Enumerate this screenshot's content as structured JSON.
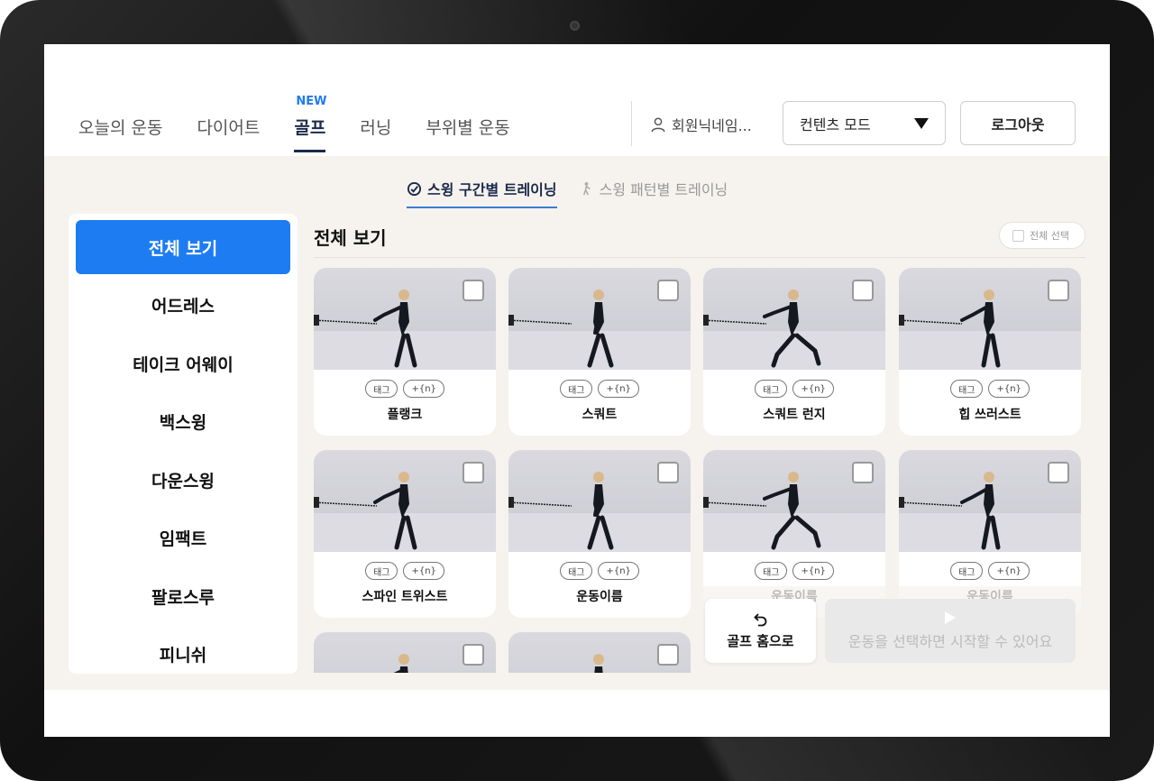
{
  "nav": {
    "items": [
      {
        "label": "오늘의 운동",
        "active": false
      },
      {
        "label": "다이어트",
        "active": false
      },
      {
        "label": "골프",
        "active": true,
        "badge": "NEW"
      },
      {
        "label": "러닝",
        "active": false
      },
      {
        "label": "부위별 운동",
        "active": false
      }
    ]
  },
  "header": {
    "user_name": "회원닉네임...",
    "mode_label": "컨텐츠 모드",
    "logout_label": "로그아웃"
  },
  "subtabs": [
    {
      "label": "스윙 구간별 트레이닝",
      "active": true,
      "icon": "swing-section-icon"
    },
    {
      "label": "스윙 패턴별 트레이닝",
      "active": false,
      "icon": "golfer-icon"
    }
  ],
  "sidebar": {
    "items": [
      {
        "label": "전체 보기",
        "active": true
      },
      {
        "label": "어드레스",
        "active": false
      },
      {
        "label": "테이크 어웨이",
        "active": false
      },
      {
        "label": "백스윙",
        "active": false
      },
      {
        "label": "다운스윙",
        "active": false
      },
      {
        "label": "임팩트",
        "active": false
      },
      {
        "label": "팔로스루",
        "active": false
      },
      {
        "label": "피니쉬",
        "active": false
      }
    ]
  },
  "main": {
    "title": "전체 보기",
    "select_all_label": "전체 선택",
    "cards": [
      {
        "name": "플랭크",
        "tag": "태그",
        "more": "+{n}"
      },
      {
        "name": "스쿼트",
        "tag": "태그",
        "more": "+{n}"
      },
      {
        "name": "스쿼트 런지",
        "tag": "태그",
        "more": "+{n}"
      },
      {
        "name": "힙 쓰러스트",
        "tag": "태그",
        "more": "+{n}"
      },
      {
        "name": "스파인 트위스트",
        "tag": "태그",
        "more": "+{n}"
      },
      {
        "name": "운동이름",
        "tag": "태그",
        "more": "+{n}"
      },
      {
        "name": "운동이름",
        "tag": "태그",
        "more": "+{n}"
      },
      {
        "name": "운동이름",
        "tag": "태그",
        "more": "+{n}"
      },
      {
        "name": "",
        "tag": "",
        "more": ""
      },
      {
        "name": "",
        "tag": "",
        "more": ""
      }
    ]
  },
  "actions": {
    "home_label": "골프 홈으로",
    "start_label": "운동을 선택하면 시작할 수 있어요"
  },
  "colors": {
    "accent": "#1e7cf2",
    "nav_active": "#1b2a4a",
    "background": "#f6f3ee"
  }
}
